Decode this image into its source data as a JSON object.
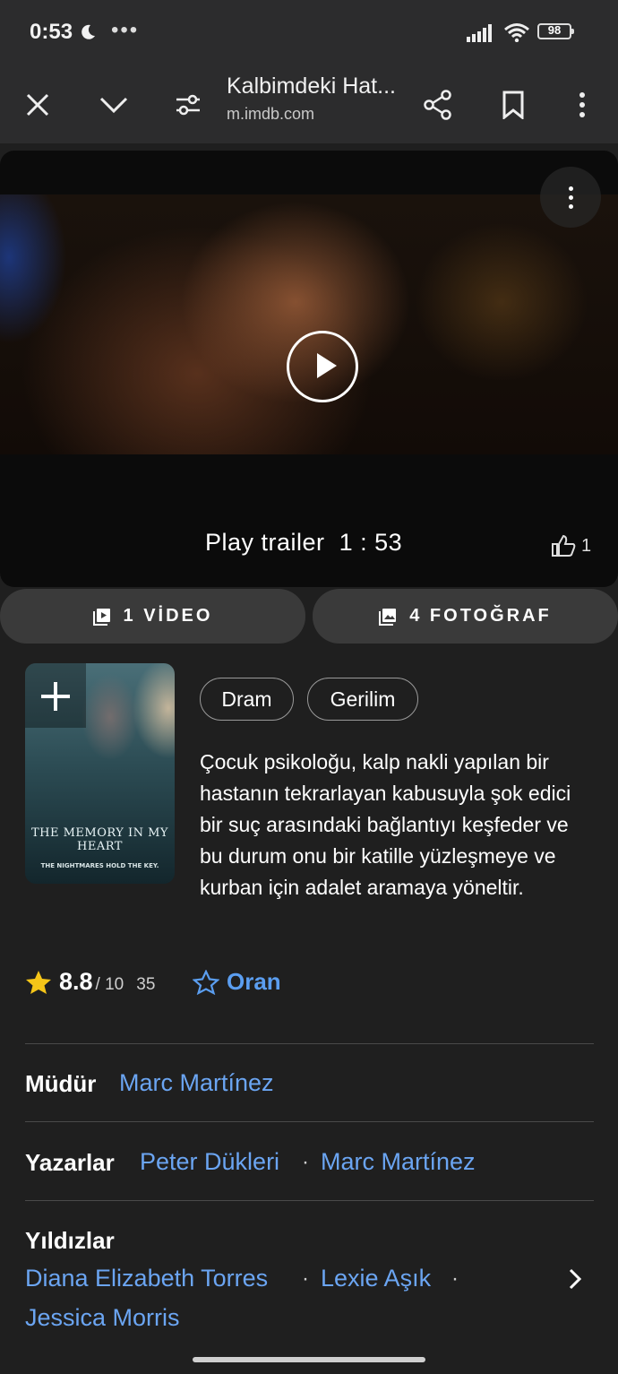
{
  "status_bar": {
    "time": "0:53",
    "dots": "•••",
    "battery": "98"
  },
  "browser": {
    "title": "Kalbimdeki Hat...",
    "url": "m.imdb.com"
  },
  "video": {
    "trailer_label": "Play trailer",
    "duration": "1 : 53",
    "likes": "1"
  },
  "media": {
    "videos_label": "1 VİDEO",
    "photos_label": "4 FOTOĞRAF"
  },
  "poster": {
    "title": "THE MEMORY IN MY HEART",
    "tagline": "THE NIGHTMARES HOLD THE KEY."
  },
  "genres": [
    "Dram",
    "Gerilim"
  ],
  "description": "Çocuk psikoloğu, kalp nakli yapılan bir hastanın tekrarlayan kabusuyla şok edici bir suç arasındaki bağlantıyı keşfeder ve bu durum onu bir katille yüzleşmeye ve kurban için adalet aramaya yöneltir.",
  "rating": {
    "score": "8.8",
    "out_of": "/ 10",
    "count": "35",
    "rate_label": "Oran"
  },
  "credits": {
    "director_label": "Müdür",
    "director": "Marc Martínez",
    "writers_label": "Yazarlar",
    "writers": [
      "Peter Dükleri",
      "Marc Martínez"
    ],
    "stars_label": "Yıldızlar",
    "stars": [
      "Diana Elizabeth Torres",
      "Lexie Aşık",
      "Jessica Morris"
    ],
    "separator": "·"
  },
  "colors": {
    "link": "#6ba5f2",
    "star": "#f5c518",
    "background": "#1f1f1f"
  }
}
